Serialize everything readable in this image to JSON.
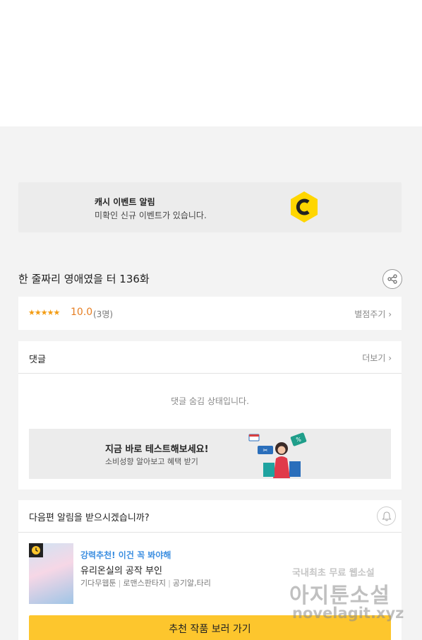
{
  "event_banner": {
    "title": "캐시 이벤트 알림",
    "subtitle": "미확인 신규 이벤트가 있습니다.",
    "icon": "cash-coin-icon",
    "coin_color": "#ffd600"
  },
  "episode": {
    "title": "한 줄짜리 영애였을 터 136화",
    "share_icon": "share-icon"
  },
  "rating": {
    "stars": "★★★★★",
    "score": "10.0",
    "count": "(3명)",
    "rate_link": "별점주기 ›"
  },
  "comments": {
    "title": "댓글",
    "more": "더보기 ›",
    "hidden_message": "댓글 숨김 상태입니다."
  },
  "test_banner": {
    "title": "지금 바로 테스트해보세요!",
    "subtitle": "소비성향 알아보고 혜택 받기"
  },
  "notify": {
    "question": "다음편 알림을 받으시겠습니까?",
    "bell_icon": "bell-icon"
  },
  "recommendation": {
    "tag": "강력추천! 이건 꼭 봐야해",
    "title": "유리온실의 공작 부인",
    "meta": [
      "기다무웹툰",
      "로맨스판타지",
      "공기알,타리"
    ],
    "cta": "추천 작품 보러 가기",
    "cta_color": "#fdc62d"
  },
  "watermark": {
    "line1": "국내최초 무료 웹소설",
    "line2": "아지툰소설",
    "line3": "novelagit.xyz"
  }
}
